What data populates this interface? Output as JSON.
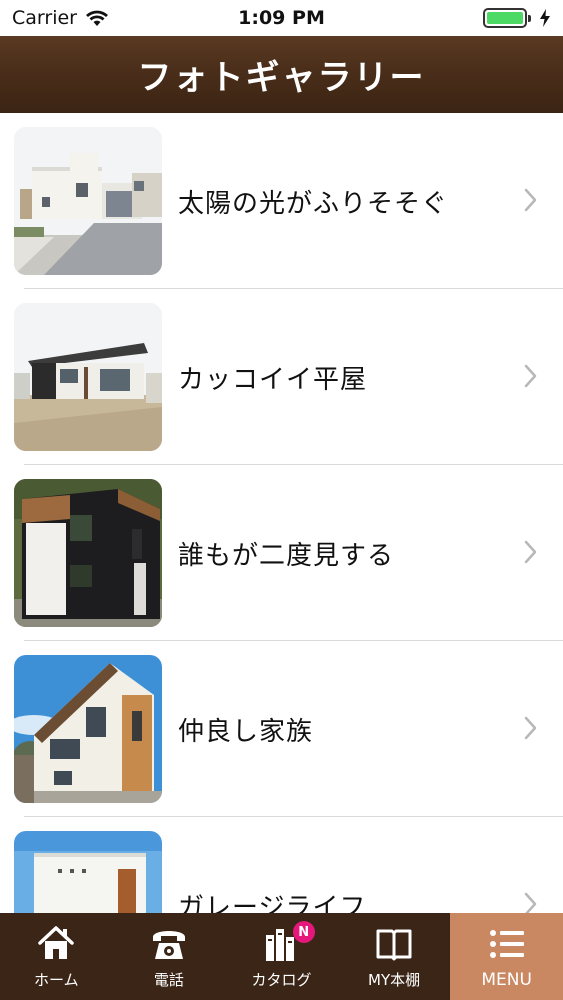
{
  "status_bar": {
    "carrier": "Carrier",
    "time": "1:09 PM",
    "battery_percent": 100,
    "battery_color": "#4cd964"
  },
  "header": {
    "title": "フォトギャラリー",
    "background_color": "#4a2e1a"
  },
  "gallery": {
    "items": [
      {
        "label": "太陽の光がふりそそぐ",
        "thumbnail": "white-two-story-house-photo"
      },
      {
        "label": "カッコイイ平屋",
        "thumbnail": "single-story-house-photo"
      },
      {
        "label": "誰もが二度見する",
        "thumbnail": "black-white-house-photo"
      },
      {
        "label": "仲良し家族",
        "thumbnail": "white-wood-house-photo"
      },
      {
        "label": "ガレージライフ",
        "thumbnail": "garage-house-photo"
      }
    ]
  },
  "tabbar": {
    "tabs": [
      {
        "label": "ホーム",
        "icon": "home-icon"
      },
      {
        "label": "電話",
        "icon": "phone-icon"
      },
      {
        "label": "カタログ",
        "icon": "catalog-icon",
        "badge": "N"
      },
      {
        "label": "MY本棚",
        "icon": "book-icon"
      },
      {
        "label": "MENU",
        "icon": "menu-icon",
        "active": true
      }
    ],
    "active_color": "#c98862",
    "badge_color": "#e5177a"
  }
}
